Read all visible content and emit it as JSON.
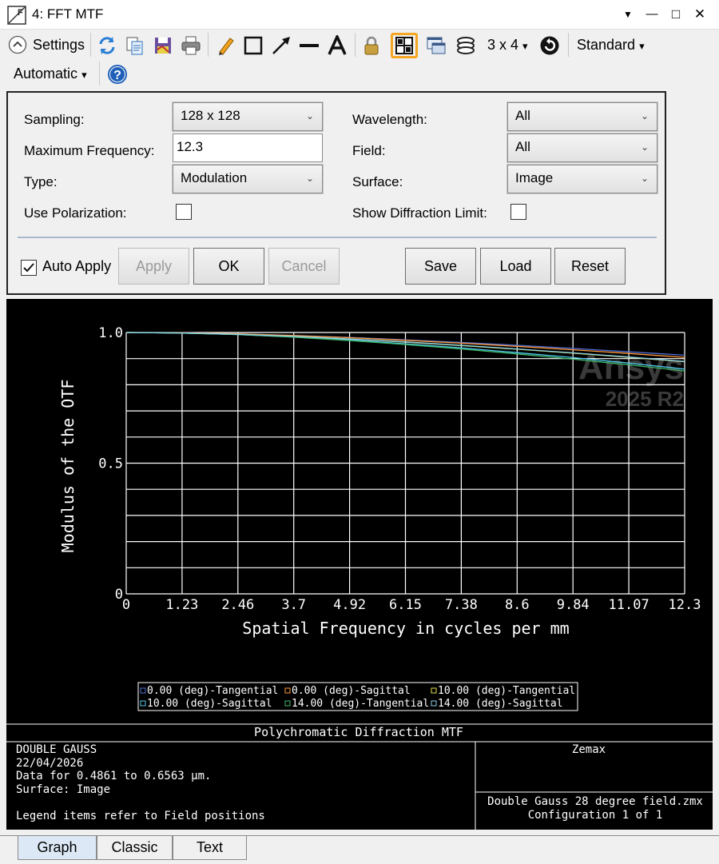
{
  "window": {
    "title": "4: FFT MTF",
    "controls": {
      "dropdown": "▼",
      "minimize": "—",
      "maximize": "□",
      "close": "✕"
    }
  },
  "toolbar": {
    "settings_label": "Settings",
    "layout_label": "3 x 4",
    "layout_arrow": "▾",
    "standard_label": "Standard",
    "standard_arrow": "▾",
    "automatic_label": "Automatic",
    "automatic_arrow": "▾",
    "icons": [
      "refresh-icon",
      "copy-icon",
      "save-icon",
      "print-icon",
      "pencil-icon",
      "rectangle-icon",
      "arrow-icon",
      "line-icon",
      "text-icon",
      "lock-icon",
      "grid-icon",
      "window-icon",
      "layers-icon",
      "rotate-icon",
      "help-icon"
    ],
    "accent_color": "#f5a623"
  },
  "settings": {
    "sampling": {
      "label": "Sampling:",
      "value": "128 x 128"
    },
    "max_frequency": {
      "label": "Maximum Frequency:",
      "value": "12.3"
    },
    "type": {
      "label": "Type:",
      "value": "Modulation"
    },
    "use_polarization": {
      "label": "Use Polarization:",
      "checked": false
    },
    "wavelength": {
      "label": "Wavelength:",
      "value": "All"
    },
    "field": {
      "label": "Field:",
      "value": "All"
    },
    "surface": {
      "label": "Surface:",
      "value": "Image"
    },
    "show_diffraction_limit": {
      "label": "Show Diffraction Limit:",
      "checked": false
    },
    "auto_apply": {
      "label": "Auto Apply",
      "checked": true
    },
    "buttons": {
      "apply": "Apply",
      "ok": "OK",
      "cancel": "Cancel",
      "save": "Save",
      "load": "Load",
      "reset": "Reset"
    }
  },
  "graph": {
    "watermark_line1": "Ansys",
    "watermark_line2": "2025 R2",
    "plot_title": "Polychromatic Diffraction MTF",
    "info_left": [
      "DOUBLE GAUSS",
      "22/04/2026",
      "Data for 0.4861 to 0.6563 µm.",
      "Surface: Image",
      "",
      "Legend items refer to Field positions"
    ],
    "info_right_top": "Zemax",
    "info_right_bottom": [
      "Double Gauss 28 degree field.zmx",
      "Configuration 1 of 1"
    ]
  },
  "chart_data": {
    "type": "line",
    "xlabel": "Spatial Frequency in cycles per mm",
    "ylabel": "Modulus of the OTF",
    "xlim": [
      0,
      12.3
    ],
    "ylim": [
      0,
      1.0
    ],
    "x_ticks": [
      "0",
      "1.23",
      "2.46",
      "3.7",
      "4.92",
      "6.15",
      "7.38",
      "8.6",
      "9.84",
      "11.07",
      "12.3"
    ],
    "y_ticks": [
      "0",
      "0.5",
      "1.0"
    ],
    "grid": true,
    "legend_position": "bottom",
    "x": [
      0,
      1.23,
      2.46,
      3.69,
      4.92,
      6.15,
      7.38,
      8.61,
      9.84,
      11.07,
      12.3
    ],
    "series": [
      {
        "name": "0.00 (deg)-Tangential",
        "color": "#4f6fd8",
        "values": [
          1.0,
          0.999,
          0.995,
          0.989,
          0.981,
          0.972,
          0.962,
          0.951,
          0.939,
          0.926,
          0.913
        ]
      },
      {
        "name": "0.00 (deg)-Sagittal",
        "color": "#ff9a3c",
        "values": [
          1.0,
          0.999,
          0.995,
          0.988,
          0.98,
          0.97,
          0.959,
          0.947,
          0.934,
          0.92,
          0.905
        ]
      },
      {
        "name": "10.00 (deg)-Tangential",
        "color": "#e6e04a",
        "values": [
          1.0,
          0.998,
          0.993,
          0.985,
          0.975,
          0.963,
          0.95,
          0.936,
          0.921,
          0.905,
          0.888
        ]
      },
      {
        "name": "10.00 (deg)-Sagittal",
        "color": "#50c8e8",
        "values": [
          1.0,
          0.998,
          0.992,
          0.983,
          0.971,
          0.957,
          0.941,
          0.923,
          0.904,
          0.883,
          0.86
        ]
      },
      {
        "name": "14.00 (deg)-Tangential",
        "color": "#3fb86a",
        "values": [
          1.0,
          0.998,
          0.992,
          0.982,
          0.969,
          0.954,
          0.937,
          0.918,
          0.898,
          0.876,
          0.853
        ]
      },
      {
        "name": "14.00 (deg)-Sagittal",
        "color": "#8bd0e8",
        "values": [
          1.0,
          0.998,
          0.993,
          0.985,
          0.975,
          0.964,
          0.951,
          0.937,
          0.922,
          0.906,
          0.889
        ]
      }
    ]
  },
  "tabs": [
    "Graph",
    "Classic",
    "Text"
  ]
}
